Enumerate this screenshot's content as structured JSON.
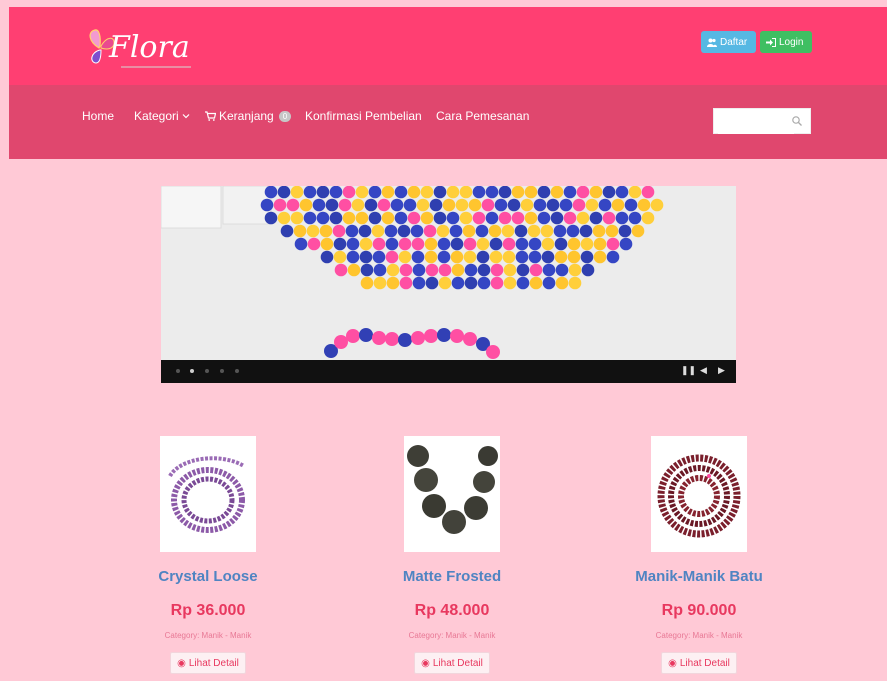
{
  "header": {
    "logo_text": "Flora",
    "daftar_label": "Daftar",
    "login_label": "Login"
  },
  "nav": {
    "items": [
      {
        "label": "Home"
      },
      {
        "label": "Kategori"
      },
      {
        "label": "Keranjang",
        "badge": "0"
      },
      {
        "label": "Konfirmasi Pembelian"
      },
      {
        "label": "Cara Pemesanan"
      }
    ],
    "search_placeholder": ""
  },
  "slider": {
    "dot_count": 5,
    "active_dot": 1
  },
  "products": [
    {
      "name": "Crystal Loose",
      "price": "Rp 36.000",
      "category": "Category: Manik - Manik",
      "button": "Lihat Detail"
    },
    {
      "name": "Matte Frosted",
      "price": "Rp 48.000",
      "category": "Category: Manik - Manik",
      "button": "Lihat Detail"
    },
    {
      "name": "Manik-Manik Batu",
      "price": "Rp 90.000",
      "category": "Category: Manik - Manik",
      "button": "Lihat Detail"
    }
  ],
  "colors": {
    "header": "#ff3f72",
    "navbar": "#e0476e",
    "page_bg": "#ffc9d6",
    "product_name": "#4f84c2",
    "price": "#e8385f"
  }
}
